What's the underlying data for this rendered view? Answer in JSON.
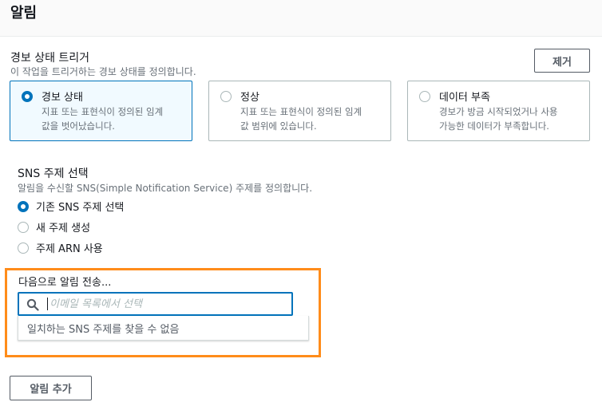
{
  "header": {
    "title": "알림"
  },
  "trigger": {
    "label": "경보 상태 트리거",
    "description": "이 작업을 트리거하는 경보 상태를 정의합니다.",
    "remove_label": "제거",
    "options": [
      {
        "title": "경보 상태",
        "description": "지표 또는 표현식이 정의된 임계\n값을 벗어났습니다.",
        "selected": true
      },
      {
        "title": "정상",
        "description": "지표 또는 표현식이 정의된 임계\n값 범위에 있습니다.",
        "selected": false
      },
      {
        "title": "데이터 부족",
        "description": "경보가 방금 시작되었거나 사용\n가능한 데이터가 부족합니다.",
        "selected": false
      }
    ]
  },
  "sns": {
    "label": "SNS 주제 선택",
    "description": "알림을 수신할 SNS(Simple Notification Service) 주제를 정의합니다.",
    "options": [
      {
        "label": "기존 SNS 주제 선택",
        "selected": true
      },
      {
        "label": "새 주제 생성",
        "selected": false
      },
      {
        "label": "주제 ARN 사용",
        "selected": false
      }
    ]
  },
  "send": {
    "label": "다음으로 알림 전송...",
    "search_placeholder": "이메일 목록에서 선택",
    "search_value": "",
    "search_icon": "search-icon",
    "no_match_message": "일치하는 SNS 주제를 찾을 수 없음"
  },
  "add_notification_label": "알림 추가",
  "colors": {
    "accent": "#0073bb",
    "highlight": "#ff8c1a",
    "selected_tile_bg": "#f1faff",
    "muted_text": "#687078"
  }
}
